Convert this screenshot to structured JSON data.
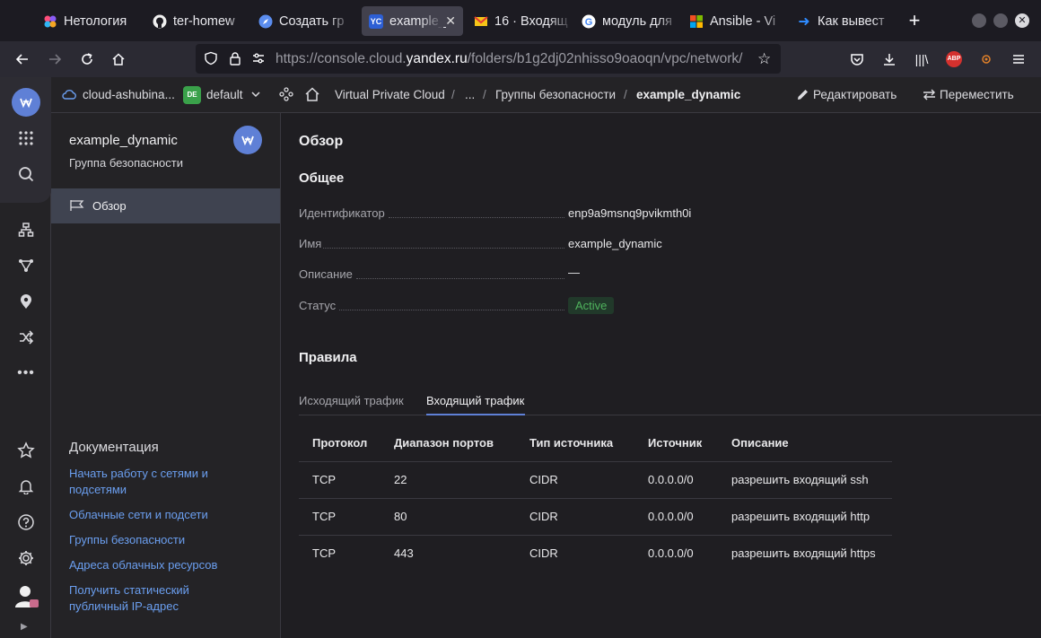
{
  "browser": {
    "tabs": [
      {
        "label": "Нетология",
        "icon": "netology-icon",
        "active": false
      },
      {
        "label": "ter-homew",
        "icon": "github-icon",
        "active": false
      },
      {
        "label": "Создать гр",
        "icon": "compass-icon",
        "active": false
      },
      {
        "label": "example_",
        "icon": "yc-icon",
        "active": true
      },
      {
        "label": "16 · Входящ",
        "icon": "mail-icon",
        "active": false
      },
      {
        "label": "модуль для",
        "icon": "google-icon",
        "active": false
      },
      {
        "label": "Ansible - Vi",
        "icon": "microsoft-icon",
        "active": false
      },
      {
        "label": "Как вывест",
        "icon": "arrow-icon",
        "active": false
      }
    ],
    "yc_favicon_text": "YC",
    "url_prefix": "https://console.cloud.",
    "url_domain": "yandex.ru",
    "url_path": "/folders/b1g2dj02nhisso9oaoqn/vpc/network/",
    "abp_label": "ABP"
  },
  "header": {
    "cloud": "cloud-ashubina...",
    "folder_badge": "DE",
    "folder": "default",
    "crumbs": [
      "Virtual Private Cloud",
      "/",
      "...",
      "/",
      "Группы безопасности",
      "/"
    ],
    "current": "example_dynamic",
    "edit_label": "Редактировать",
    "move_label": "Переместить"
  },
  "sidebar": {
    "title": "example_dynamic",
    "subtitle": "Группа безопасности",
    "nav": [
      {
        "label": "Обзор"
      }
    ],
    "docs_title": "Документация",
    "docs": [
      "Начать работу с сетями и подсетями",
      "Облачные сети и подсети",
      "Группы безопасности",
      "Адреса облачных ресурсов",
      "Получить статический публичный IP-адрес"
    ]
  },
  "main": {
    "title": "Обзор",
    "general_title": "Общее",
    "fields": [
      {
        "label": "Идентификатор",
        "value": "enp9a9msnq9pvikmth0i"
      },
      {
        "label": "Имя",
        "value": "example_dynamic"
      },
      {
        "label": "Описание",
        "value": "—"
      },
      {
        "label": "Статус",
        "value": "Active"
      }
    ],
    "rules_title": "Правила",
    "tabs": [
      {
        "label": "Исходящий трафик",
        "active": false
      },
      {
        "label": "Входящий трафик",
        "active": true
      }
    ],
    "table": {
      "headers": [
        "Протокол",
        "Диапазон портов",
        "Тип источника",
        "Источник",
        "Описание"
      ],
      "rows": [
        [
          "TCP",
          "22",
          "CIDR",
          "0.0.0.0/0",
          "разрешить входящий ssh"
        ],
        [
          "TCP",
          "80",
          "CIDR",
          "0.0.0.0/0",
          "разрешить входящий http"
        ],
        [
          "TCP",
          "443",
          "CIDR",
          "0.0.0.0/0",
          "разрешить входящий https"
        ]
      ]
    }
  },
  "colors": {
    "accent": "#5f80d6",
    "link": "#6b9ff0",
    "status": "#3fa14b"
  }
}
